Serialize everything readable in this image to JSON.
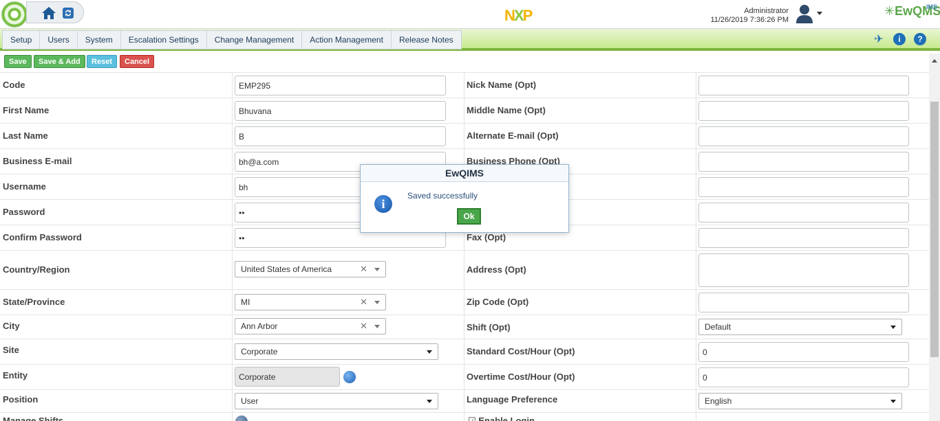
{
  "header": {
    "logo_text": "NXP",
    "user_name": "Administrator",
    "datetime": "11/26/2019 7:36:26 PM",
    "brand": "EwQMS",
    "brand_sup": "IMS"
  },
  "nav": {
    "items": [
      "Setup",
      "Users",
      "System",
      "Escalation Settings",
      "Change Management",
      "Action Management",
      "Release Notes"
    ]
  },
  "toolbar": {
    "save": "Save",
    "save_add": "Save & Add",
    "reset": "Reset",
    "cancel": "Cancel"
  },
  "form": {
    "code": {
      "label": "Code",
      "value": "EMP295"
    },
    "nick_name": {
      "label": "Nick Name (Opt)",
      "value": ""
    },
    "first_name": {
      "label": "First Name",
      "value": "Bhuvana"
    },
    "middle_name": {
      "label": "Middle Name (Opt)",
      "value": ""
    },
    "last_name": {
      "label": "Last Name",
      "value": "B"
    },
    "alt_email": {
      "label": "Alternate E-mail (Opt)",
      "value": ""
    },
    "business_email": {
      "label": "Business E-mail",
      "value": "bh@a.com"
    },
    "business_phone": {
      "label": "Business Phone (Opt)",
      "value": ""
    },
    "username": {
      "label": "Username",
      "value": "bh"
    },
    "password": {
      "label": "Password",
      "value": "••"
    },
    "confirm_password": {
      "label": "Confirm Password",
      "value": "••"
    },
    "fax": {
      "label": "Fax (Opt)",
      "value": ""
    },
    "country": {
      "label": "Country/Region",
      "value": "United States of America"
    },
    "address": {
      "label": "Address (Opt)",
      "value": ""
    },
    "state": {
      "label": "State/Province",
      "value": "MI"
    },
    "zip": {
      "label": "Zip Code (Opt)",
      "value": ""
    },
    "city": {
      "label": "City",
      "value": "Ann Arbor"
    },
    "shift": {
      "label": "Shift (Opt)",
      "value": "Default"
    },
    "site": {
      "label": "Site",
      "value": "Corporate"
    },
    "std_cost": {
      "label": "Standard Cost/Hour (Opt)",
      "value": "0"
    },
    "entity": {
      "label": "Entity",
      "value": "Corporate"
    },
    "ot_cost": {
      "label": "Overtime Cost/Hour (Opt)",
      "value": "0"
    },
    "position": {
      "label": "Position",
      "value": "User"
    },
    "language": {
      "label": "Language Preference",
      "value": "English"
    },
    "manage_shifts": {
      "label": "Manage Shifts"
    },
    "enable_login": {
      "label": "Enable Login"
    }
  },
  "modal": {
    "title": "EwQIMS",
    "message": "Saved successfully",
    "ok": "Ok"
  },
  "colors": {
    "save_green": "#5cb85c",
    "reset_blue": "#5bc0de",
    "cancel_red": "#d9534f",
    "nav_green": "#7cb63f"
  }
}
